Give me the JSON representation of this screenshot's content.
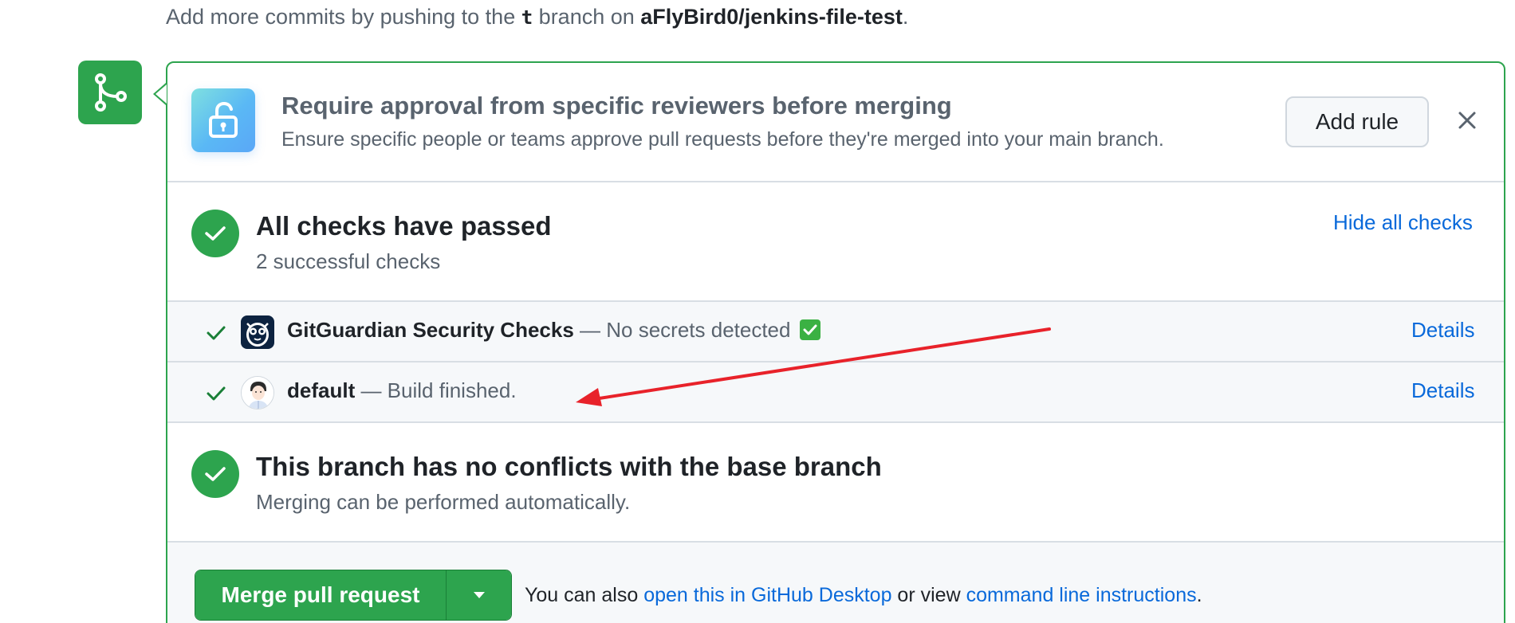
{
  "top_hint": {
    "prefix": "Add more commits by pushing to the ",
    "branch": "t",
    "middle": " branch on ",
    "repo": "aFlyBird0/jenkins-file-test",
    "suffix": "."
  },
  "icons": {
    "merge": "git-merge-icon",
    "lock": "unlock-icon",
    "close": "x-icon",
    "check": "check-icon",
    "caret": "triangle-down-icon"
  },
  "rule_prompt": {
    "title": "Require approval from specific reviewers before merging",
    "description": "Ensure specific people or teams approve pull requests before they're merged into your main branch.",
    "add_rule_label": "Add rule"
  },
  "checks": {
    "title": "All checks have passed",
    "subtitle": "2 successful checks",
    "hide_label": "Hide all checks",
    "items": [
      {
        "name": "GitGuardian Security Checks",
        "status": " — No secrets detected ",
        "details_label": "Details"
      },
      {
        "name": "default",
        "status": " — Build finished.",
        "details_label": "Details"
      }
    ]
  },
  "conflicts": {
    "title": "This branch has no conflicts with the base branch",
    "subtitle": "Merging can be performed automatically."
  },
  "merge": {
    "button_label": "Merge pull request",
    "note_prefix": "You can also ",
    "link_desktop": "open this in GitHub Desktop",
    "note_middle": " or view ",
    "link_cli": "command line instructions",
    "note_suffix": "."
  },
  "colors": {
    "success": "#2da44e",
    "link": "#0969da",
    "annotation_arrow": "#e8222a"
  }
}
